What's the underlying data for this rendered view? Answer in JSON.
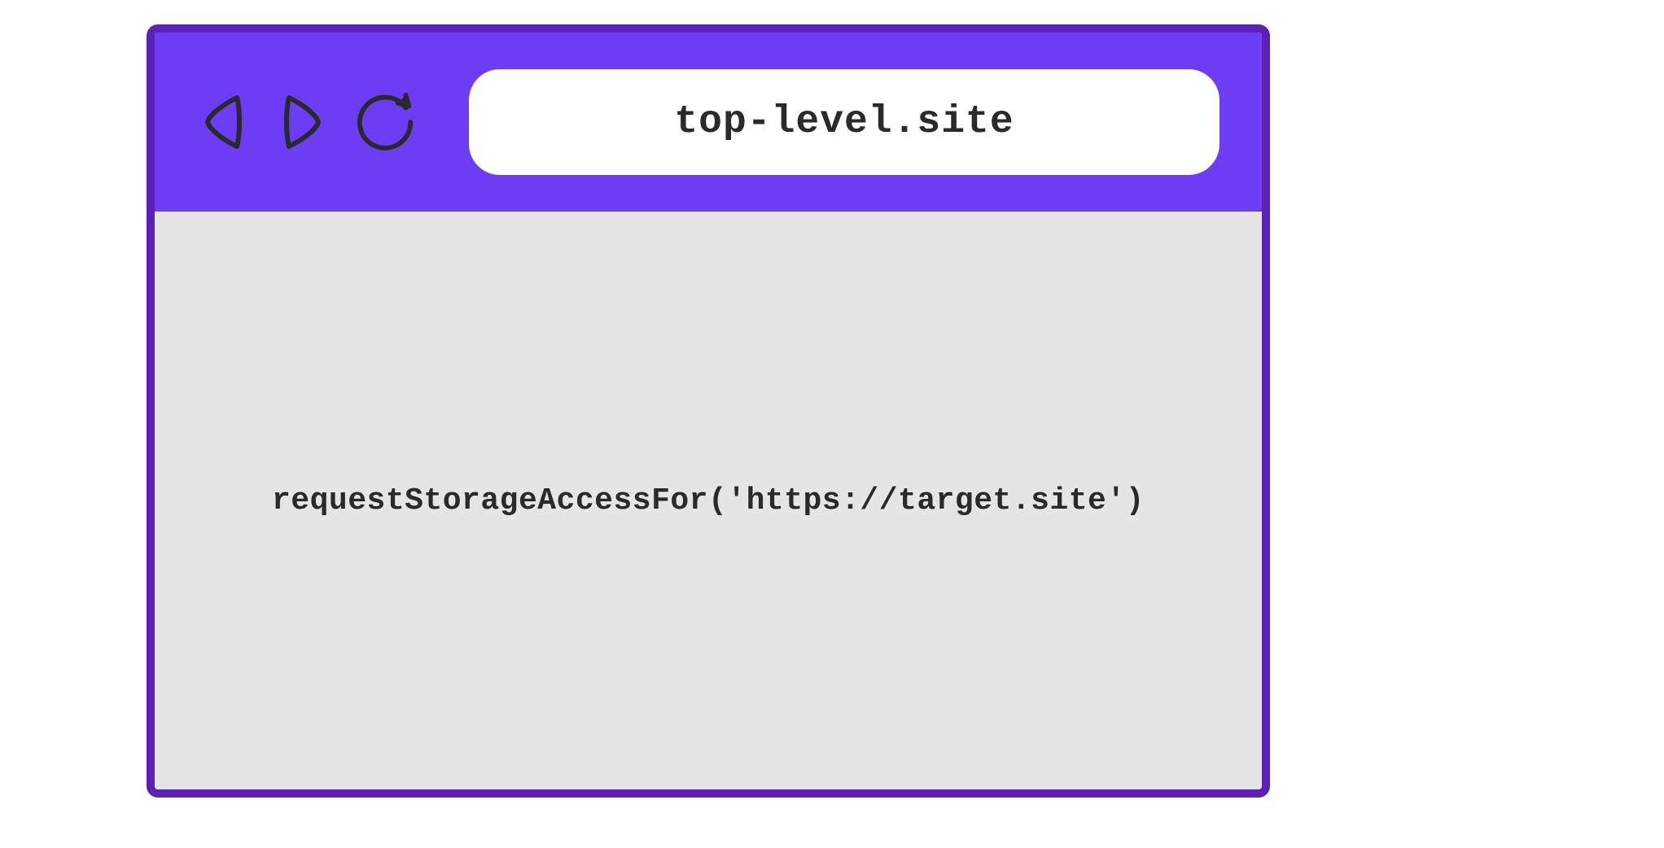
{
  "browser": {
    "address": "top-level.site",
    "content_code": "requestStorageAccessFor('https://target.site')"
  }
}
